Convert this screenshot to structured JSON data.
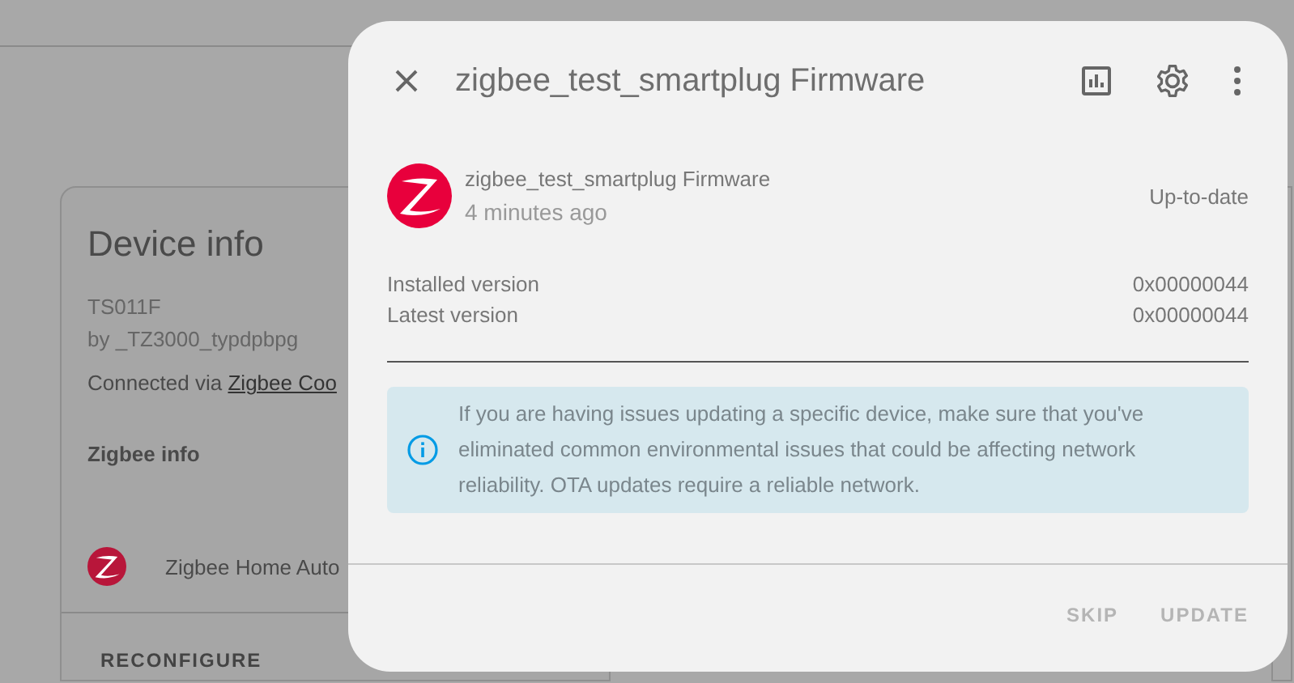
{
  "background_page": {
    "device_card": {
      "title": "Device info",
      "model": "TS011F",
      "manufacturer": "by _TZ3000_typdpbpg",
      "connected_via_label": "Connected via ",
      "connected_via_link": "Zigbee Coo",
      "section_title": "Zigbee info",
      "integration": "Zigbee Home Auto",
      "action": "RECONFIGURE"
    }
  },
  "dialog": {
    "title": "zigbee_test_smartplug Firmware",
    "entity": {
      "name": "zigbee_test_smartplug Firmware",
      "time": "4 minutes ago",
      "status": "Up-to-date"
    },
    "versions": [
      {
        "label": "Installed version",
        "value": "0x00000044"
      },
      {
        "label": "Latest version",
        "value": "0x00000044"
      }
    ],
    "alert": {
      "text_before": "If you are having issues updating a specific device, make sure that you've eliminated ",
      "link": "common environmental issues",
      "text_after": " that could be affecting network reliability. OTA updates require a reliable network."
    },
    "buttons": [
      {
        "label": "SKIP",
        "disabled": true
      },
      {
        "label": "UPDATE",
        "disabled": true
      }
    ]
  }
}
